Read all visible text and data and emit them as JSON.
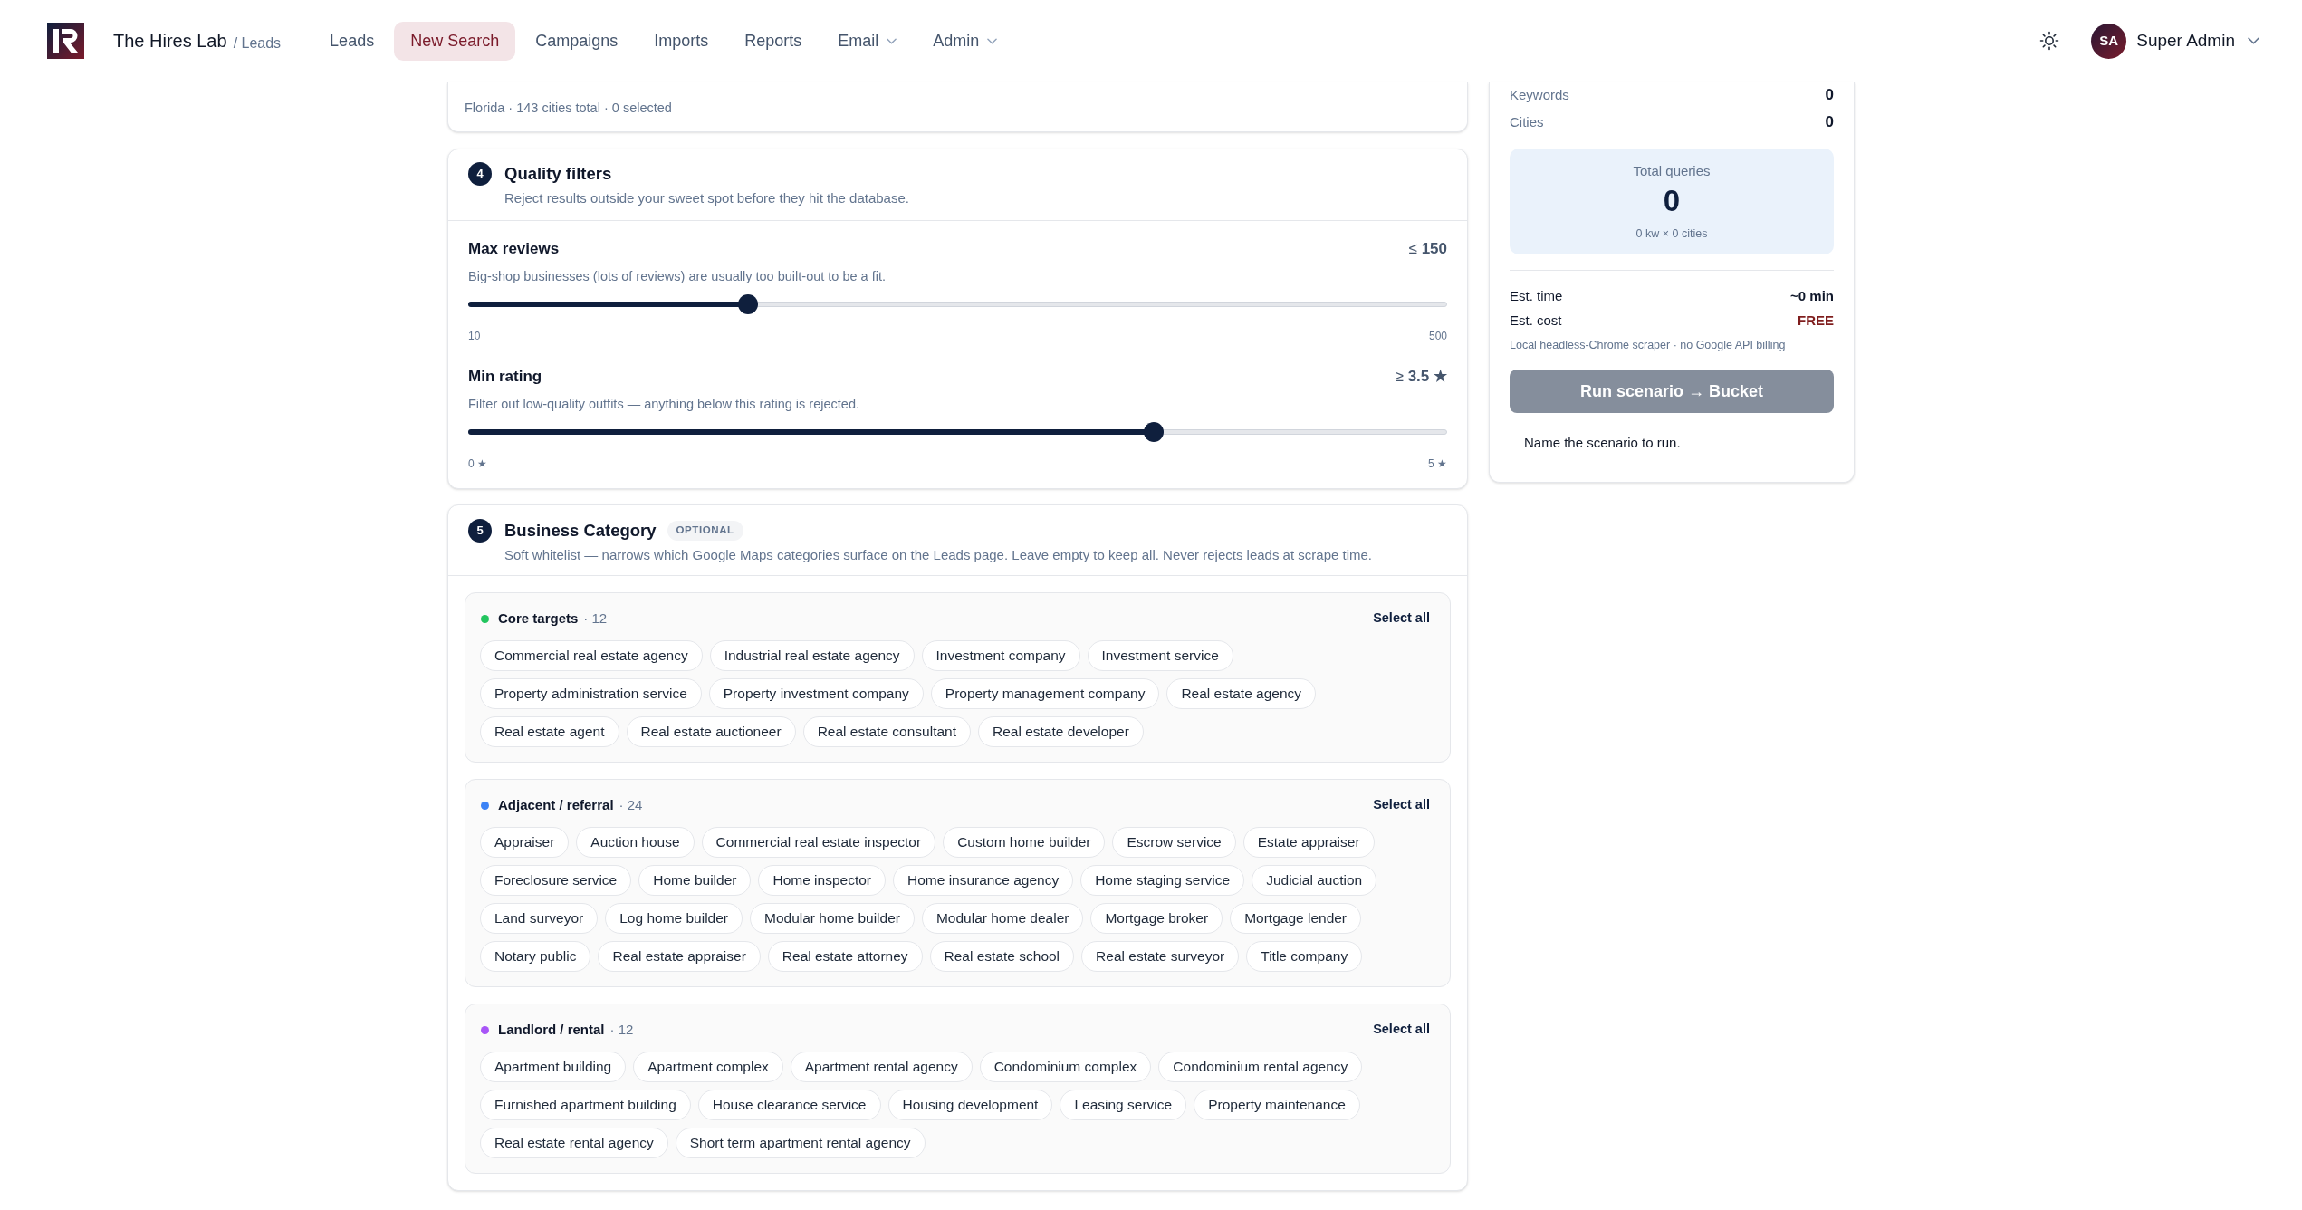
{
  "header": {
    "brand": "The Hires Lab",
    "section": "/ Leads",
    "nav": [
      {
        "label": "Leads",
        "selected": false,
        "kind": "link"
      },
      {
        "label": "New Search",
        "selected": true,
        "kind": "link"
      },
      {
        "label": "Campaigns",
        "selected": false,
        "kind": "link"
      },
      {
        "label": "Imports",
        "selected": false,
        "kind": "link"
      },
      {
        "label": "Reports",
        "selected": false,
        "kind": "link"
      },
      {
        "label": "Email",
        "selected": false,
        "kind": "menu"
      },
      {
        "label": "Admin",
        "selected": false,
        "kind": "menu"
      }
    ],
    "user": {
      "initials": "SA",
      "name": "Super Admin"
    }
  },
  "location_card": {
    "summary": "Florida · 143 cities total · 0 selected"
  },
  "quality_filters": {
    "step": "4",
    "title": "Quality filters",
    "subtitle": "Reject results outside your sweet spot before they hit the database.",
    "sliders": [
      {
        "label": "Max reviews",
        "reading": "≤ **150**",
        "description": "Big-shop businesses (lots of reviews) are usually too built-out to be a fit.",
        "level": 0.286,
        "min_label": "10",
        "max_label": "500"
      },
      {
        "label": "Min rating",
        "reading": "≥ **3.5 ★**",
        "description": "Filter out low-quality outfits — anything below this rating is rejected.",
        "level": 0.7,
        "min_label": "0 ★",
        "max_label": "5 ★"
      }
    ]
  },
  "business_category": {
    "step": "5",
    "title": "Business Category",
    "badge": "OPTIONAL",
    "subtitle": "Soft whitelist — narrows which Google Maps categories surface on the Leads page. Leave empty to keep all. Never rejects leads at scrape time.",
    "groups": [
      {
        "name": "Core targets",
        "count": "· 12",
        "color": "#22c55e",
        "action": "Select all",
        "chips": [
          {
            "label": "Commercial real estate agency",
            "selected": false
          },
          {
            "label": "Industrial real estate agency",
            "selected": false
          },
          {
            "label": "Investment company",
            "selected": false
          },
          {
            "label": "Investment service",
            "selected": false
          },
          {
            "label": "Property administration service",
            "selected": false
          },
          {
            "label": "Property investment company",
            "selected": false
          },
          {
            "label": "Property management company",
            "selected": false
          },
          {
            "label": "Real estate agency",
            "selected": false
          },
          {
            "label": "Real estate agent",
            "selected": false
          },
          {
            "label": "Real estate auctioneer",
            "selected": false
          },
          {
            "label": "Real estate consultant",
            "selected": false
          },
          {
            "label": "Real estate developer",
            "selected": false
          }
        ]
      },
      {
        "name": "Adjacent / referral",
        "count": "· 24",
        "color": "#3b82f6",
        "action": "Select all",
        "chips": [
          {
            "label": "Appraiser",
            "selected": false
          },
          {
            "label": "Auction house",
            "selected": false
          },
          {
            "label": "Commercial real estate inspector",
            "selected": false
          },
          {
            "label": "Custom home builder",
            "selected": false
          },
          {
            "label": "Escrow service",
            "selected": false
          },
          {
            "label": "Estate appraiser",
            "selected": false
          },
          {
            "label": "Foreclosure service",
            "selected": false
          },
          {
            "label": "Home builder",
            "selected": false
          },
          {
            "label": "Home inspector",
            "selected": false
          },
          {
            "label": "Home insurance agency",
            "selected": false
          },
          {
            "label": "Home staging service",
            "selected": false
          },
          {
            "label": "Judicial auction",
            "selected": false
          },
          {
            "label": "Land surveyor",
            "selected": false
          },
          {
            "label": "Log home builder",
            "selected": false
          },
          {
            "label": "Modular home builder",
            "selected": false
          },
          {
            "label": "Modular home dealer",
            "selected": false
          },
          {
            "label": "Mortgage broker",
            "selected": false
          },
          {
            "label": "Mortgage lender",
            "selected": false
          },
          {
            "label": "Notary public",
            "selected": false
          },
          {
            "label": "Real estate appraiser",
            "selected": false
          },
          {
            "label": "Real estate attorney",
            "selected": false
          },
          {
            "label": "Real estate school",
            "selected": false
          },
          {
            "label": "Real estate surveyor",
            "selected": false
          },
          {
            "label": "Title company",
            "selected": false
          }
        ]
      },
      {
        "name": "Landlord / rental",
        "count": "· 12",
        "color": "#a855f7",
        "action": "Select all",
        "chips": [
          {
            "label": "Apartment building",
            "selected": false
          },
          {
            "label": "Apartment complex",
            "selected": false
          },
          {
            "label": "Apartment rental agency",
            "selected": false
          },
          {
            "label": "Condominium complex",
            "selected": false
          },
          {
            "label": "Condominium rental agency",
            "selected": false
          },
          {
            "label": "Furnished apartment building",
            "selected": false
          },
          {
            "label": "House clearance service",
            "selected": false
          },
          {
            "label": "Housing development",
            "selected": false
          },
          {
            "label": "Leasing service",
            "selected": false
          },
          {
            "label": "Property maintenance",
            "selected": false
          },
          {
            "label": "Real estate rental agency",
            "selected": false
          },
          {
            "label": "Short term apartment rental agency",
            "selected": false
          }
        ]
      }
    ]
  },
  "summary": {
    "rows": [
      {
        "label": "Keywords",
        "value": "0"
      },
      {
        "label": "Cities",
        "value": "0"
      }
    ],
    "total": {
      "label": "Total queries",
      "value": "0",
      "formula": "0 kw × 0 cities"
    },
    "estimates": [
      {
        "label": "Est. time",
        "value": "~0 min",
        "color": "#0f172a"
      },
      {
        "label": "Est. cost",
        "value": "FREE",
        "color": "#7f1d1d"
      }
    ],
    "note": "Local headless-Chrome scraper · no Google API billing",
    "run_button": {
      "label": "Run scenario → Bucket",
      "disabled": true
    },
    "hint": "Name the scenario to run."
  }
}
